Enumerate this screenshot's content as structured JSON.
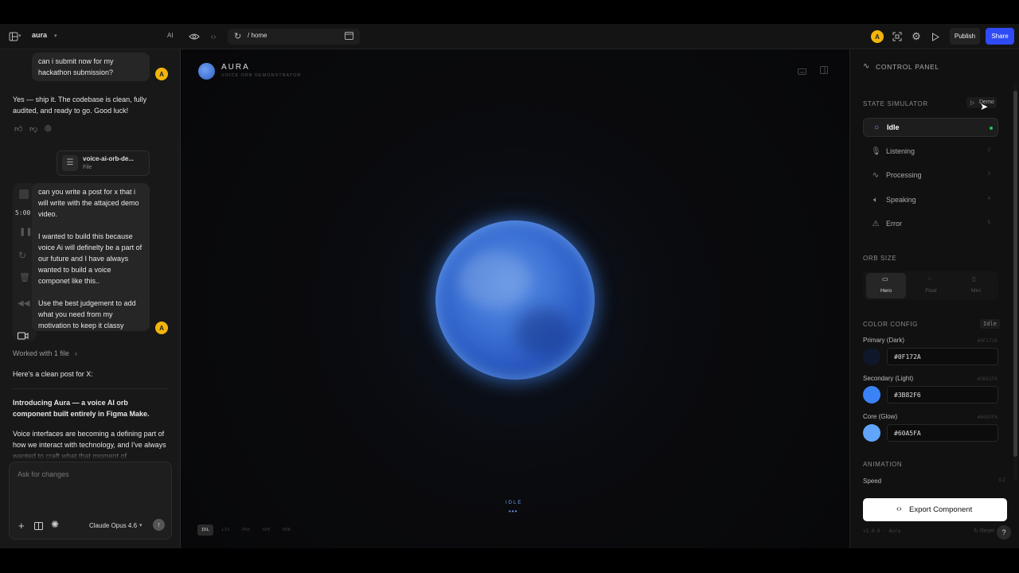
{
  "topbar": {
    "project_name": "aura",
    "ai_label": "AI",
    "path": "/ home",
    "avatar_initial": "A",
    "publish_label": "Publish",
    "share_label": "Share"
  },
  "chat": {
    "msg1": "can i submit now for my hackathon submission?",
    "reply1": "Yes — ship it. The codebase is clean, fully audited, and ready to go. Good luck!",
    "file_name": "voice-ai-orb-de...",
    "file_type": "File",
    "recording_time": "5:00",
    "msg2_p1": "can you write a post for x that i will write with the attajced demo video.",
    "msg2_p2": "I wanted to build this because voice Ai will definelty be a part of our future and I have always wanted to build a voice componet like this..",
    "msg2_p3": "Use the best judgement to add what you need from my motivation to keep it classy",
    "worked_label": "Worked with 1 file",
    "post_intro": "Here's a clean post for X:",
    "post_heading": "Introducing Aura — a voice AI orb component built entirely in Figma Make.",
    "post_body": "Voice interfaces are becoming a defining part of how we interact with technology, and I've always wanted to craft what that moment of",
    "input_placeholder": "Ask for changes",
    "model_name": "Claude Opus 4.6",
    "user_initial": "A"
  },
  "canvas": {
    "title": "AURA",
    "subtitle": "VOICE ORB DEMONSTRATOR",
    "status": "IDLE",
    "state_tabs": [
      "IDL",
      "LIS",
      "PRO",
      "SPE",
      "ERR"
    ],
    "active_tab": 0
  },
  "panel": {
    "title": "CONTROL PANEL",
    "state_simulator_label": "STATE SIMULATOR",
    "demo_label": "Demo",
    "states": [
      {
        "label": "Idle",
        "key": "",
        "icon": "circle-icon",
        "active": true
      },
      {
        "label": "Listening",
        "key": "2",
        "icon": "mic-icon",
        "active": false
      },
      {
        "label": "Processing",
        "key": "3",
        "icon": "activity-icon",
        "active": false
      },
      {
        "label": "Speaking",
        "key": "4",
        "icon": "speaker-icon",
        "active": false
      },
      {
        "label": "Error",
        "key": "5",
        "icon": "warning-icon",
        "active": false
      }
    ],
    "orb_size_label": "ORB SIZE",
    "sizes": [
      "Hero",
      "Float",
      "Mini"
    ],
    "color_config_label": "COLOR CONFIG",
    "color_badge": "Idle",
    "colors": [
      {
        "label": "Primary (Dark)",
        "hex": "#0F172A",
        "hex_right": "#0F172A"
      },
      {
        "label": "Secondary (Light)",
        "hex": "#3B82F6",
        "hex_right": "#3B82F6"
      },
      {
        "label": "Core (Glow)",
        "hex": "#60A5FA",
        "hex_right": "#60A5FA"
      }
    ],
    "animation_label": "ANIMATION",
    "speed_label": "Speed",
    "speed_value": "0.2",
    "export_label": "Export Component",
    "version": "v1.0.0 · Aura",
    "reset_label": "Reset",
    "help_label": "?"
  },
  "colors": {
    "accent_blue": "#2f4bf5",
    "avatar_yellow": "#f2b50a",
    "active_green": "#22c55e"
  }
}
